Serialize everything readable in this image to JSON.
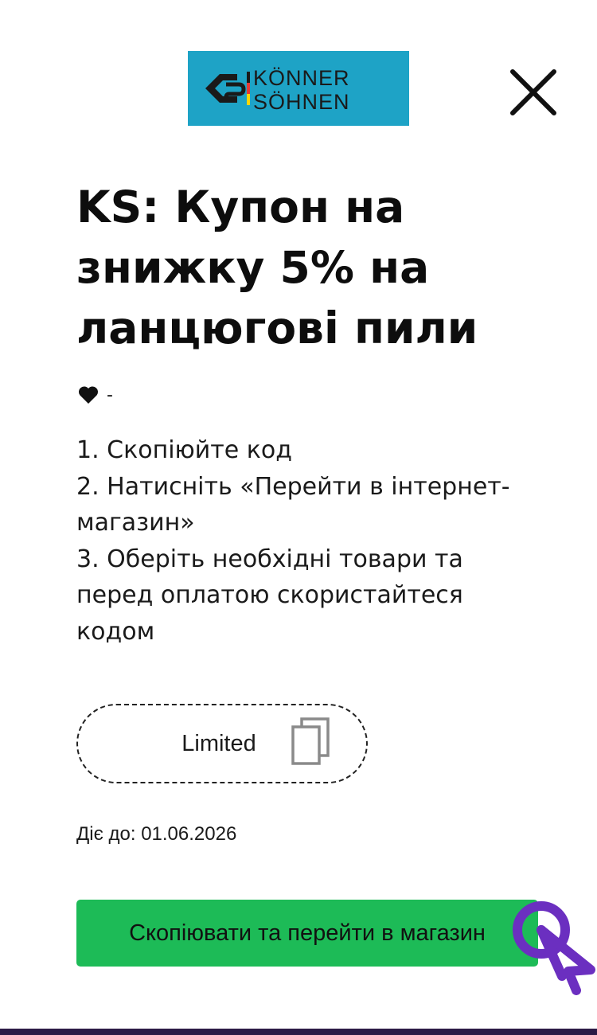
{
  "logo": {
    "line1": "KÖNNER",
    "line2": "SÖHNEN",
    "background": "#1ea3c6"
  },
  "close": {
    "icon": "close-icon"
  },
  "coupon_title": "KS: Купон на знижку 5% на ланцюгові пили",
  "likes": {
    "icon": "heart-icon",
    "count": "-"
  },
  "instructions": [
    "1. Скопіюйте код",
    "2. Натисніть «Перейти в інтернет-магазин»",
    "3. Оберіть необхідні товари та перед оплатою скористайтеся кодом"
  ],
  "coupon": {
    "code": "Limited",
    "copy_icon": "copy-icon"
  },
  "expiry": "Діє до: 01.06.2026",
  "cta": {
    "label": "Скопіювати та перейти в магазин",
    "color": "#1dbb57"
  },
  "colors": {
    "accent_purple": "#6b2fc0",
    "bottom_bar": "#2b1a45"
  }
}
